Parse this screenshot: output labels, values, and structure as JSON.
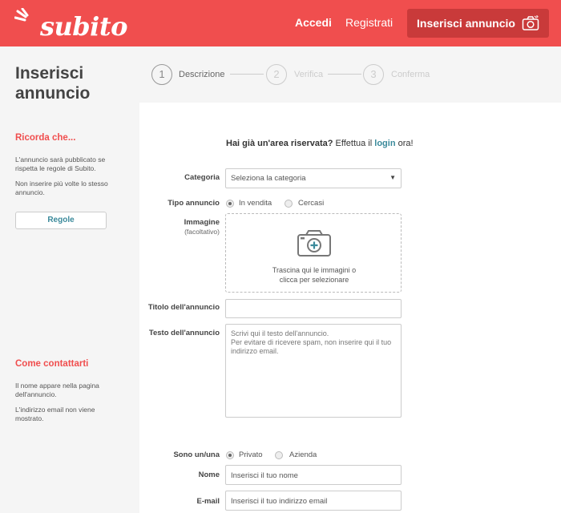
{
  "header": {
    "logo": "subito",
    "accedi": "Accedi",
    "registrati": "Registrati",
    "inserisci_button": "Inserisci annuncio"
  },
  "sidebar": {
    "title": "Inserisci annuncio",
    "ricorda_heading": "Ricorda che...",
    "ricorda_p1": "L'annuncio sarà pubblicato se rispetta le regole di Subito.",
    "ricorda_p2": "Non inserire più volte lo stesso annuncio.",
    "regole_button": "Regole",
    "contatti_heading": "Come contattarti",
    "contatti_p1": "Il nome appare nella pagina dell'annuncio.",
    "contatti_p2": "L'indirizzo email non viene mostrato."
  },
  "stepper": [
    {
      "number": "1",
      "label": "Descrizione"
    },
    {
      "number": "2",
      "label": "Verifica"
    },
    {
      "number": "3",
      "label": "Conferma"
    }
  ],
  "form": {
    "login_question": "Hai già un'area riservata?",
    "login_pre": "Effettua il",
    "login_link": "login",
    "login_post": "ora!",
    "categoria_label": "Categoria",
    "categoria_value": "Seleziona la categoria",
    "tipo_label": "Tipo annuncio",
    "tipo_options": [
      "In vendita",
      "Cercasi"
    ],
    "immagine_label": "Immagine",
    "immagine_sub": "(facoltativo)",
    "dropzone_line1": "Trascina qui le immagini o",
    "dropzone_line2": "clicca per selezionare",
    "titolo_label": "Titolo dell'annuncio",
    "titolo_value": "",
    "testo_label": "Testo dell'annuncio",
    "testo_placeholder_line1": "Scrivi qui il testo dell'annuncio.",
    "testo_placeholder_line2": "Per evitare di ricevere spam, non inserire qui il tuo indirizzo email.",
    "sono_label": "Sono un/una",
    "sono_options": [
      "Privato",
      "Azienda"
    ],
    "nome_label": "Nome",
    "nome_placeholder": "Inserisci il tuo nome",
    "email_label": "E-mail",
    "email_placeholder": "Inserisci il tuo indirizzo email"
  },
  "colors": {
    "brand": "#f04e4e",
    "brand_dark": "#c93a3a",
    "link": "#3b8a9b"
  }
}
